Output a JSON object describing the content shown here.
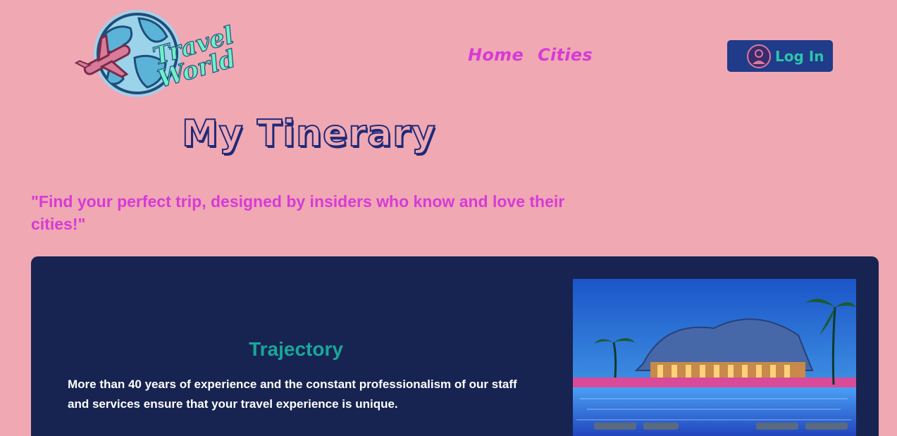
{
  "header": {
    "logo_text_line1": "Travel",
    "logo_text_line2": "World",
    "nav": [
      {
        "label": "Home"
      },
      {
        "label": "Cities"
      }
    ],
    "login_label": "Log In"
  },
  "hero": {
    "title": "My Tinerary",
    "tagline": "\"Find your perfect trip, designed by insiders who know and love their cities!\""
  },
  "card": {
    "title": "Trajectory",
    "text": "More than 40 years of experience and the constant professionalism of our staff and services ensure that your travel experience is unique."
  },
  "colors": {
    "background": "#f0a8b3",
    "nav_accent": "#d63bd6",
    "login_bg": "#1f3b8a",
    "login_text": "#2ec4a8",
    "card_bg": "#172451",
    "card_title": "#1aa69a",
    "title_outline": "#1e2a78"
  },
  "icons": {
    "logo": "globe-with-airplane-logo",
    "login": "user-avatar-icon"
  }
}
